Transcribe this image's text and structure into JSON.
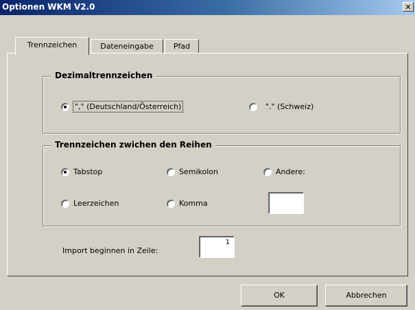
{
  "window": {
    "title": "Optionen WKM V2.0",
    "close_label": "✕"
  },
  "tabs": [
    {
      "label": "Trennzeichen",
      "active": true
    },
    {
      "label": "Dateneingabe",
      "active": false
    },
    {
      "label": "Pfad",
      "active": false
    }
  ],
  "decimal_group": {
    "title": "Dezimaltrennzeichen",
    "options": [
      {
        "label": "\",\" (Deutschland/Österreich)",
        "checked": true
      },
      {
        "label": "\".\" (Schweiz)",
        "checked": false
      }
    ]
  },
  "separator_group": {
    "title": "Trennzeichen zwichen den Reihen",
    "options": [
      {
        "label": "Tabstop",
        "checked": true
      },
      {
        "label": "Semikolon",
        "checked": false
      },
      {
        "label": "Andere:",
        "checked": false
      },
      {
        "label": "Leerzeichen",
        "checked": false
      },
      {
        "label": "Komma",
        "checked": false
      }
    ],
    "other_value": ""
  },
  "import_row": {
    "label": "Import beginnen in Zeile:",
    "value": "1"
  },
  "buttons": {
    "ok": "OK",
    "cancel": "Abbrechen"
  }
}
